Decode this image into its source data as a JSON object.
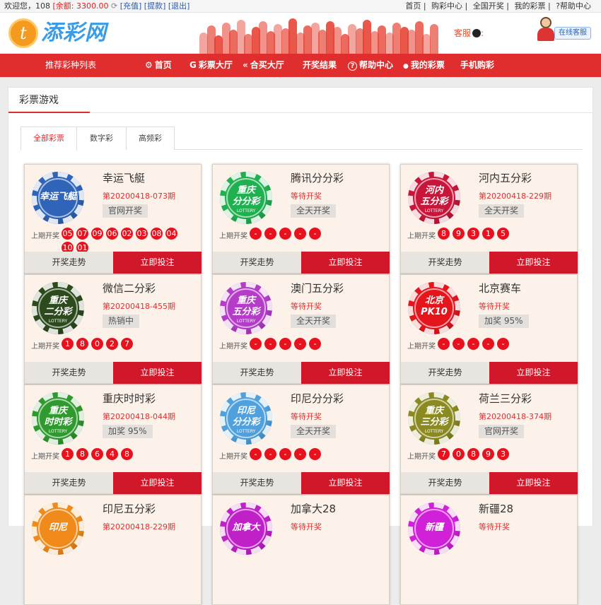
{
  "topbar": {
    "welcome": "欢迎您，108",
    "balance": "[余额: 3300.00",
    "recharge": "[充值]",
    "withdraw": "[提款]",
    "logout": "[退出]",
    "links": [
      "首页",
      "购彩中心",
      "全国开奖",
      "我的彩票",
      "?帮助中心"
    ]
  },
  "header": {
    "logo_mark": "t",
    "logo_text": "添彩网",
    "kefu": "客服",
    "online_service": "在线客服"
  },
  "nav": {
    "recommend": "推荐彩种列表",
    "items": [
      "首页",
      "彩票大厅",
      "合买大厅",
      "开奖结果",
      "帮助中心",
      "我的彩票",
      "手机购彩"
    ],
    "icons": [
      "⚙",
      "G",
      "«",
      "",
      "?",
      "●",
      ""
    ]
  },
  "panel": {
    "title": "彩票游戏",
    "tabs": [
      "全部彩票",
      "数字彩",
      "高频彩"
    ]
  },
  "card_common": {
    "last_label": "上期开奖",
    "trend": "开奖走势",
    "bet": "立即投注"
  },
  "cards": [
    {
      "name": "幸运飞艇",
      "period": "第20200418-073期",
      "badge": "官网开奖",
      "balls": [
        "05",
        "07",
        "09",
        "06",
        "02",
        "03",
        "08",
        "04",
        "10",
        "01"
      ],
      "chip": {
        "t1": "幸运飞艇",
        "t2": "",
        "t3": "",
        "color": "#2f64b8"
      }
    },
    {
      "name": "腾讯分分彩",
      "period": "等待开奖",
      "badge": "全天开奖",
      "balls": [
        "-",
        "-",
        "-",
        "-",
        "-"
      ],
      "chip": {
        "t1": "重庆",
        "t2": "分分彩",
        "t3": "LOTTERY",
        "color": "#1fb050"
      }
    },
    {
      "name": "河内五分彩",
      "period": "第20200418-229期",
      "badge": "全天开奖",
      "balls": [
        "8",
        "9",
        "3",
        "1",
        "5"
      ],
      "chip": {
        "t1": "河内",
        "t2": "五分彩",
        "t3": "LOTTERY",
        "color": "#c8153a"
      }
    },
    {
      "name": "微信二分彩",
      "period": "第20200418-455期",
      "badge": "热销中",
      "balls": [
        "1",
        "8",
        "0",
        "2",
        "7"
      ],
      "chip": {
        "t1": "重庆",
        "t2": "二分彩",
        "t3": "LOTTERY",
        "color": "#2c4a1c"
      }
    },
    {
      "name": "澳门五分彩",
      "period": "等待开奖",
      "badge": "全天开奖",
      "balls": [
        "-",
        "-",
        "-",
        "-",
        "-"
      ],
      "chip": {
        "t1": "重庆",
        "t2": "五分彩",
        "t3": "LOTTERY",
        "color": "#b43cc8"
      }
    },
    {
      "name": "北京赛车",
      "period": "等待开奖",
      "badge": "加奖 95%",
      "balls": [
        "-",
        "-",
        "-",
        "-",
        "-"
      ],
      "chip": {
        "t1": "北京",
        "t2": "PK10",
        "t3": "",
        "color": "#e5151c"
      }
    },
    {
      "name": "重庆时时彩",
      "period": "第20200418-044期",
      "badge": "加奖 95%",
      "balls": [
        "1",
        "8",
        "6",
        "4",
        "8"
      ],
      "chip": {
        "t1": "重庆",
        "t2": "时时彩",
        "t3": "LOTTERY",
        "color": "#2f9a2e"
      }
    },
    {
      "name": "印尼分分彩",
      "period": "等待开奖",
      "badge": "全天开奖",
      "balls": [
        "-",
        "-",
        "-",
        "-",
        "-"
      ],
      "chip": {
        "t1": "印尼",
        "t2": "分分彩",
        "t3": "LOTTERY",
        "color": "#4fa0dc"
      }
    },
    {
      "name": "荷兰三分彩",
      "period": "第20200418-374期",
      "badge": "官网开奖",
      "balls": [
        "7",
        "0",
        "8",
        "9",
        "3"
      ],
      "chip": {
        "t1": "重庆",
        "t2": "三分彩",
        "t3": "LOTTERY",
        "color": "#8a8a20"
      }
    },
    {
      "name": "印尼五分彩",
      "period": "第20200418-229期",
      "badge": "",
      "balls": [],
      "chip": {
        "t1": "印尼",
        "t2": "",
        "t3": "",
        "color": "#f08a1a"
      }
    },
    {
      "name": "加拿大28",
      "period": "等待开奖",
      "badge": "",
      "balls": [],
      "chip": {
        "t1": "加拿大",
        "t2": "",
        "t3": "",
        "color": "#c020c8"
      }
    },
    {
      "name": "新疆28",
      "period": "等待开奖",
      "badge": "",
      "balls": [],
      "chip": {
        "t1": "新疆",
        "t2": "",
        "t3": "",
        "color": "#d020d8"
      }
    }
  ]
}
